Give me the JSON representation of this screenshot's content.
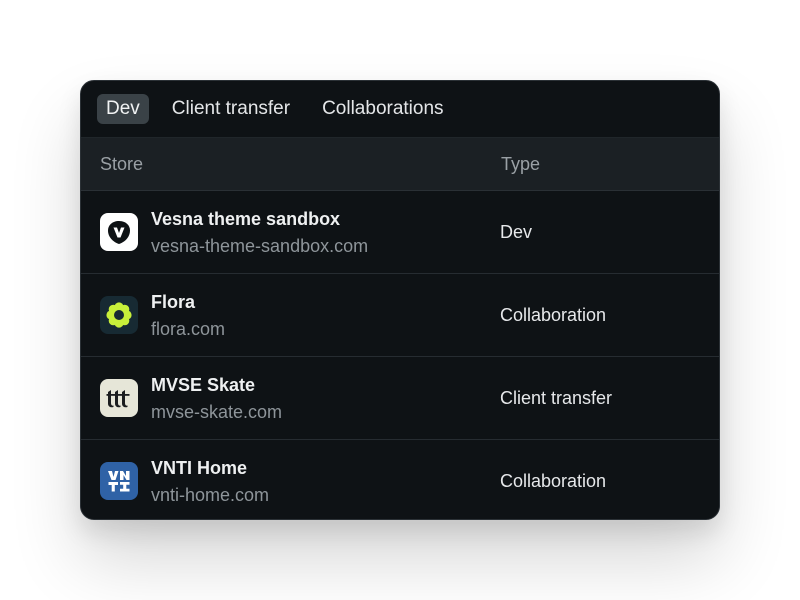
{
  "tabs": [
    {
      "label": "Dev",
      "active": true
    },
    {
      "label": "Client transfer",
      "active": false
    },
    {
      "label": "Collaborations",
      "active": false
    }
  ],
  "table": {
    "headers": {
      "store": "Store",
      "type": "Type"
    },
    "rows": [
      {
        "name": "Vesna theme sandbox",
        "domain": "vesna-theme-sandbox.com",
        "type": "Dev",
        "icon": "vesna-logo-icon",
        "logo_bg": "#ffffff"
      },
      {
        "name": "Flora",
        "domain": "flora.com",
        "type": "Collaboration",
        "icon": "flora-flower-logo-icon",
        "logo_bg": "#172a33"
      },
      {
        "name": "MVSE Skate",
        "domain": "mvse-skate.com",
        "type": "Client transfer",
        "icon": "mvse-skate-logo-icon",
        "logo_bg": "#e6e6d8"
      },
      {
        "name": "VNTI Home",
        "domain": "vnti-home.com",
        "type": "Collaboration",
        "icon": "vnti-home-logo-icon",
        "logo_bg": "#2f62a6"
      }
    ]
  },
  "colors": {
    "card_bg": "#0e1215",
    "header_bg": "#1b2024",
    "active_tab_bg": "#3a4247",
    "flora_accent": "#c8f03a"
  }
}
